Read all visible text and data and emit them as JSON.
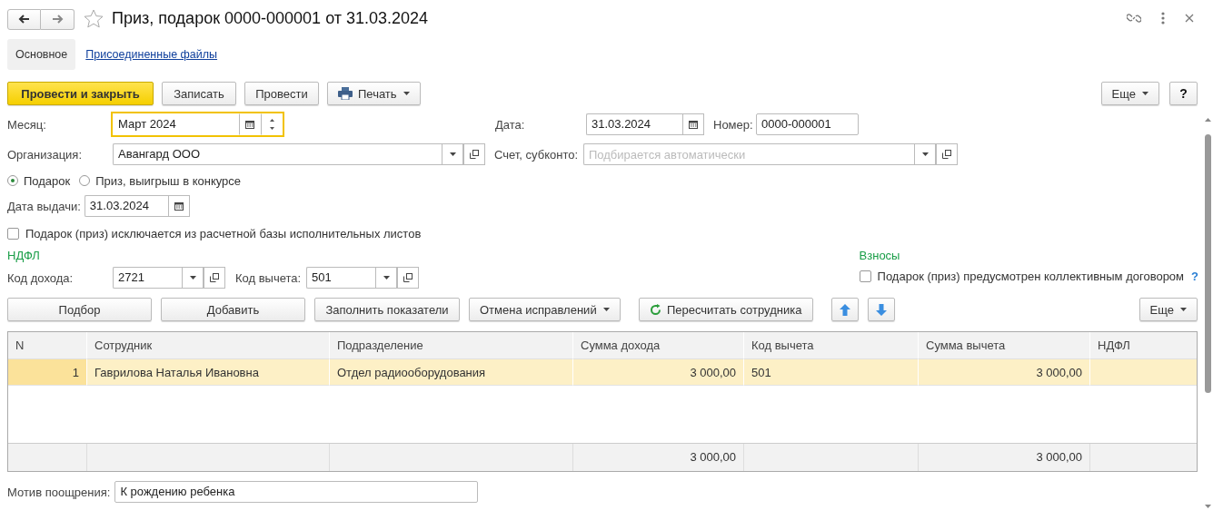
{
  "window": {
    "title": "Приз, подарок 0000-000001 от 31.03.2024",
    "favorite": false
  },
  "tabs": [
    {
      "label": "Основное",
      "selected": true
    },
    {
      "label": "Присоединенные файлы",
      "selected": false
    }
  ],
  "toolbar": {
    "buttons": [
      {
        "label": "Провести и закрыть",
        "kind": "primary"
      },
      {
        "label": "Записать",
        "kind": "plain"
      },
      {
        "label": "Провести",
        "kind": "plain"
      },
      {
        "label": "Печать",
        "kind": "print"
      }
    ],
    "more": "Еще",
    "help": "?"
  },
  "month": {
    "label": "Месяц:",
    "value": "Март 2024",
    "focused": true
  },
  "date": {
    "label": "Дата:",
    "value": "31.03.2024"
  },
  "number": {
    "label": "Номер:",
    "value": "0000-000001"
  },
  "organization": {
    "label": "Организация:",
    "value": "Авангард ООО"
  },
  "account": {
    "label": "Счет, субконто:",
    "placeholder": "Подбирается автоматически"
  },
  "gift_type": [
    {
      "label": "Подарок",
      "selected": true
    },
    {
      "label": "Приз, выигрыш в конкурсе",
      "selected": false
    }
  ],
  "issue_date": {
    "label": "Дата выдачи:",
    "value": "31.03.2024"
  },
  "excluded": {
    "label": "Подарок (приз) исключается из расчетной базы исполнительных листов",
    "checked": false
  },
  "ndfl": {
    "title": "НДФЛ",
    "income_code": {
      "label": "Код дохода:",
      "value": "2721"
    },
    "deduction_code": {
      "label": "Код вычета:",
      "value": "501"
    }
  },
  "contributions": {
    "title": "Взносы",
    "checkbox": {
      "label": "Подарок (приз) предусмотрен коллективным договором",
      "checked": false
    },
    "help": "?"
  },
  "table_toolbar": {
    "buttons": [
      {
        "label": "Подбор",
        "kind": "wide"
      },
      {
        "label": "Добавить",
        "kind": "wide"
      },
      {
        "label": "Заполнить показатели",
        "kind": "plain"
      },
      {
        "label": "Отмена исправлений",
        "kind": "dropdown"
      },
      {
        "label": "Пересчитать сотрудника",
        "kind": "refresh"
      },
      {
        "kind": "up"
      },
      {
        "kind": "down"
      }
    ],
    "more": "Еще"
  },
  "table": {
    "columns": [
      "N",
      "Сотрудник",
      "Подразделение",
      "Сумма дохода",
      "Код вычета",
      "Сумма вычета",
      "НДФЛ"
    ],
    "rows": [
      {
        "cells": [
          "1",
          "Гаврилова Наталья Ивановна",
          "Отдел радиооборудования",
          "3 000,00",
          "501",
          "3 000,00"
        ],
        "selected": true
      }
    ],
    "totals": {
      "income_sum": "3 000,00",
      "deduction_sum": "3 000,00"
    }
  },
  "motive": {
    "label": "Мотив поощрения:",
    "value": "К рождению ребенка"
  }
}
